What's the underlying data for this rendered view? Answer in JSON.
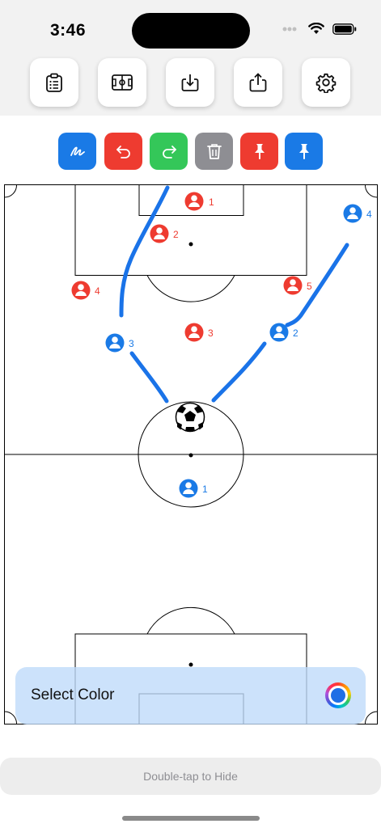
{
  "status_bar": {
    "time": "3:46"
  },
  "colors": {
    "red": "#ee3b30",
    "blue": "#1a7ae6",
    "green": "#34c759",
    "gray": "#8e8e93",
    "line_blue": "#1a73e8"
  },
  "toolbar": {
    "items": [
      {
        "name": "clipboard-icon"
      },
      {
        "name": "field-icon"
      },
      {
        "name": "download-icon"
      },
      {
        "name": "share-icon"
      },
      {
        "name": "gear-icon"
      }
    ]
  },
  "draw_tools": [
    {
      "name": "draw-icon",
      "color": "#1a7ae6"
    },
    {
      "name": "undo-icon",
      "color": "#ee3b30"
    },
    {
      "name": "redo-icon",
      "color": "#34c759"
    },
    {
      "name": "trash-icon",
      "color": "#8e8e93"
    },
    {
      "name": "red-pin-icon",
      "color": "#ee3b30"
    },
    {
      "name": "blue-pin-icon",
      "color": "#1a7ae6"
    }
  ],
  "players": {
    "red": [
      "1",
      "2",
      "3",
      "4",
      "5"
    ],
    "blue": [
      "1",
      "2",
      "3",
      "4"
    ]
  },
  "select_color": {
    "label": "Select Color",
    "selected": "#1f6fe5"
  },
  "hide_hint": "Double-tap to Hide"
}
